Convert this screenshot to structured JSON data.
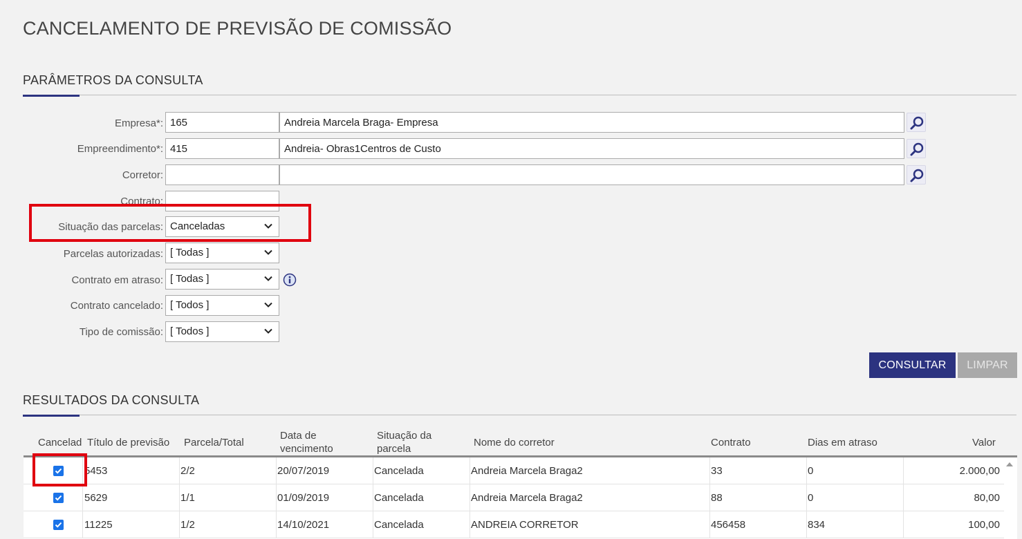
{
  "page": {
    "title": "CANCELAMENTO DE PREVISÃO DE COMISSÃO"
  },
  "params": {
    "section_title": "PARÂMETROS DA CONSULTA",
    "empresa": {
      "label": "Empresa*:",
      "code": "165",
      "name": "Andreia Marcela Braga- Empresa"
    },
    "empreendimento": {
      "label": "Empreendimento*:",
      "code": "415",
      "name": "Andreia- Obras1Centros de Custo"
    },
    "corretor": {
      "label": "Corretor:",
      "code": "",
      "name": ""
    },
    "contrato": {
      "label": "Contrato:",
      "value": ""
    },
    "situacao_parcelas": {
      "label": "Situação das parcelas:",
      "value": "Canceladas"
    },
    "parcelas_autorizadas": {
      "label": "Parcelas autorizadas:",
      "value": "[ Todas ]"
    },
    "contrato_atraso": {
      "label": "Contrato em atraso:",
      "value": "[ Todas ]"
    },
    "contrato_cancelado": {
      "label": "Contrato cancelado:",
      "value": "[ Todos ]"
    },
    "tipo_comissao": {
      "label": "Tipo de comissão:",
      "value": "[ Todos ]"
    }
  },
  "buttons": {
    "consultar": "CONSULTAR",
    "limpar": "LIMPAR"
  },
  "results": {
    "section_title": "RESULTADOS DA CONSULTA",
    "columns": {
      "cancelado": "Cancelad",
      "titulo": "Título de previsão",
      "parcela": "Parcela/Total",
      "vencimento_1": "Data de",
      "vencimento_2": "vencimento",
      "situacao_1": "Situação da",
      "situacao_2": "parcela",
      "corretor": "Nome do corretor",
      "contrato": "Contrato",
      "dias": "Dias em atraso",
      "valor": "Valor"
    },
    "rows": [
      {
        "cancelado": true,
        "titulo": "5453",
        "parcela": "2/2",
        "vencimento": "20/07/2019",
        "situacao": "Cancelada",
        "corretor": "Andreia Marcela Braga2",
        "contrato": "33",
        "dias": "0",
        "valor": "2.000,00"
      },
      {
        "cancelado": true,
        "titulo": "5629",
        "parcela": "1/1",
        "vencimento": "01/09/2019",
        "situacao": "Cancelada",
        "corretor": "Andreia Marcela Braga2",
        "contrato": "88",
        "dias": "0",
        "valor": "80,00"
      },
      {
        "cancelado": true,
        "titulo": "11225",
        "parcela": "1/2",
        "vencimento": "14/10/2021",
        "situacao": "Cancelada",
        "corretor": "ANDREIA CORRETOR",
        "contrato": "456458",
        "dias": "834",
        "valor": "100,00"
      }
    ]
  },
  "colors": {
    "primary": "#2c3380",
    "highlight": "#e0000f",
    "checkbox": "#1a73e8",
    "disabled": "#a9a9a9"
  },
  "icons": {
    "lookup": "magnifier-icon",
    "info": "info-icon",
    "dropdown": "chevron-down-icon",
    "check": "check-icon"
  }
}
